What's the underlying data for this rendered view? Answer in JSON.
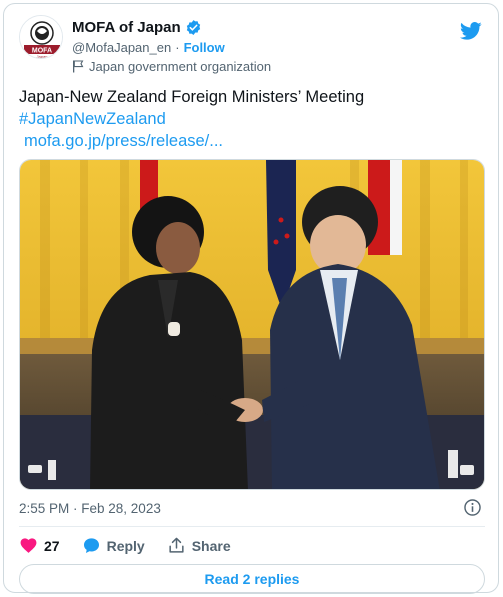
{
  "author": {
    "name": "MOFA of Japan",
    "handle": "@MofaJapan_en",
    "separator": "·",
    "follow_label": "Follow",
    "affiliation": "Japan government organization",
    "avatar_text": "MOFA",
    "avatar_subtext": "Japan"
  },
  "tweet": {
    "title_line": "Japan-New Zealand Foreign Ministers’ Meeting",
    "hashtag": "#JapanNewZealand",
    "link": "mofa.go.jp/press/release/..."
  },
  "meta": {
    "timestamp": "2:55 PM · Feb 28, 2023"
  },
  "actions": {
    "likes": "27",
    "reply_label": "Reply",
    "share_label": "Share"
  },
  "replies_button": "Read 2 replies",
  "icons": [
    "verified-icon",
    "twitter-bird-icon",
    "flag-icon",
    "info-icon",
    "heart-icon",
    "reply-bubble-icon",
    "share-icon"
  ],
  "colors": {
    "accent": "#1d9bf0",
    "like": "#f91880",
    "text": "#0f1419",
    "muted": "#536471",
    "mofa_red": "#9c1c2c"
  }
}
